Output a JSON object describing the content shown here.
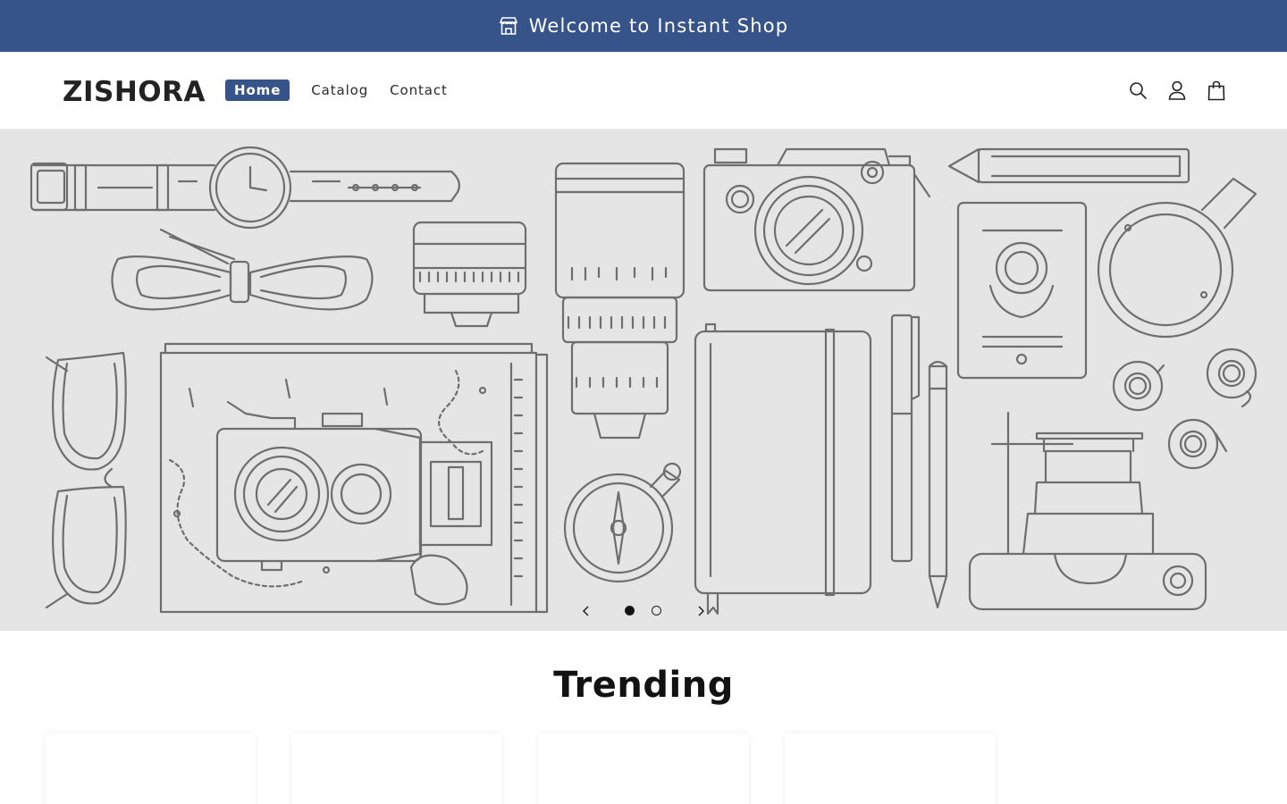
{
  "announcement": {
    "text": "Welcome to Instant Shop",
    "icon": "store-icon"
  },
  "header": {
    "logo": "ZISHORA",
    "nav": [
      {
        "label": "Home",
        "active": true
      },
      {
        "label": "Catalog",
        "active": false
      },
      {
        "label": "Contact",
        "active": false
      }
    ],
    "icons": [
      "search-icon",
      "account-icon",
      "cart-icon"
    ]
  },
  "hero": {
    "slides_total": 2,
    "current_slide": 1,
    "background": "#e5e5e5",
    "illustration": [
      "watch",
      "bow-tie",
      "lens",
      "zoom-lens",
      "camera",
      "pencil",
      "passport",
      "coffee-cup",
      "sunglasses",
      "map",
      "vintage-camera",
      "compass",
      "notebook",
      "pen",
      "tape-rolls",
      "telephoto-camera"
    ]
  },
  "trending": {
    "title": "Trending",
    "card_count": 4
  },
  "colors": {
    "brand": "#36548a",
    "text": "#121212",
    "hero_bg": "#e5e5e5"
  }
}
